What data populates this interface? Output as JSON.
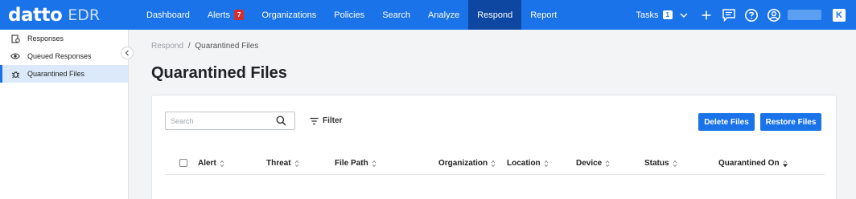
{
  "brand": {
    "name": "datto",
    "product": "EDR"
  },
  "nav": {
    "items": [
      {
        "label": "Dashboard"
      },
      {
        "label": "Alerts",
        "badge": "7"
      },
      {
        "label": "Organizations"
      },
      {
        "label": "Policies"
      },
      {
        "label": "Search"
      },
      {
        "label": "Analyze"
      },
      {
        "label": "Respond",
        "active": true
      },
      {
        "label": "Report"
      }
    ]
  },
  "topbar": {
    "tasks_label": "Tasks",
    "tasks_count": "1",
    "k_logo": "K"
  },
  "sidebar": {
    "items": [
      {
        "label": "Responses",
        "icon": "responses-icon"
      },
      {
        "label": "Queued Responses",
        "icon": "eye-icon"
      },
      {
        "label": "Quarantined Files",
        "icon": "bug-icon",
        "active": true
      }
    ]
  },
  "breadcrumb": {
    "parent": "Respond",
    "separator": "/",
    "current": "Quarantined Files"
  },
  "page": {
    "title": "Quarantined Files"
  },
  "toolbar": {
    "search_placeholder": "Search",
    "filter_label": "Filter",
    "delete_label": "Delete Files",
    "restore_label": "Restore Files"
  },
  "table": {
    "columns": [
      {
        "label": "Alert"
      },
      {
        "label": "Threat"
      },
      {
        "label": "File Path"
      },
      {
        "label": "Organization"
      },
      {
        "label": "Location"
      },
      {
        "label": "Device"
      },
      {
        "label": "Status"
      },
      {
        "label": "Quarantined On"
      }
    ]
  },
  "colors": {
    "primary": "#1a73e8",
    "active_nav": "#0d47a1",
    "alert_badge": "#d32f2f",
    "sidebar_active": "#dbe9fb"
  }
}
